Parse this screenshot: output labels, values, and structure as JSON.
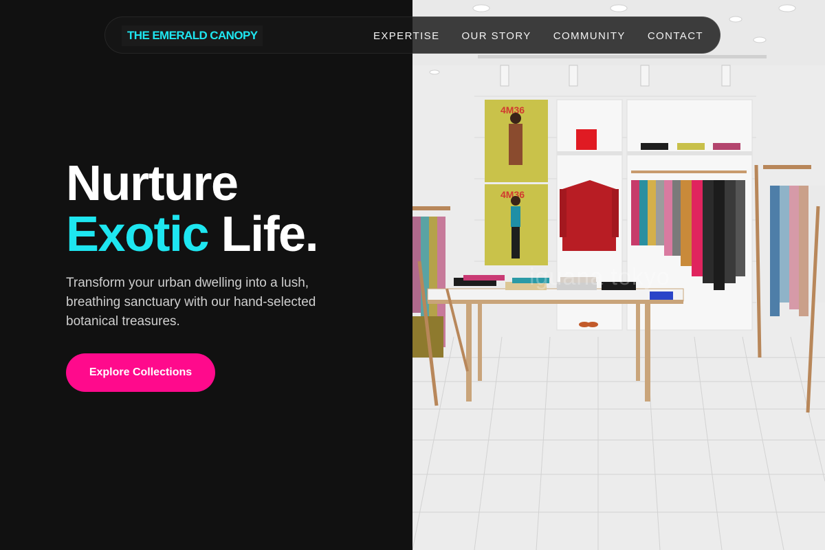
{
  "brand": {
    "name": "THE EMERALD CANOPY"
  },
  "nav": {
    "items": [
      {
        "label": "EXPERTISE"
      },
      {
        "label": "OUR STORY"
      },
      {
        "label": "COMMUNITY"
      },
      {
        "label": "CONTACT"
      }
    ]
  },
  "hero": {
    "title_line1": "Nurture",
    "title_accent": "Exotic",
    "title_word2": "Life",
    "title_dot": ".",
    "subtitle": "Transform your urban dwelling into a lush, breathing sanctuary with our hand-selected botanical treasures.",
    "cta_label": "Explore Collections"
  },
  "image": {
    "poster_text_1": "4M36",
    "poster_text_2": "4M36",
    "watermark": "iguana tokyo"
  },
  "colors": {
    "background": "#111111",
    "accent": "#1ee6f0",
    "cta": "#ff0a8c",
    "text": "#ffffff"
  }
}
